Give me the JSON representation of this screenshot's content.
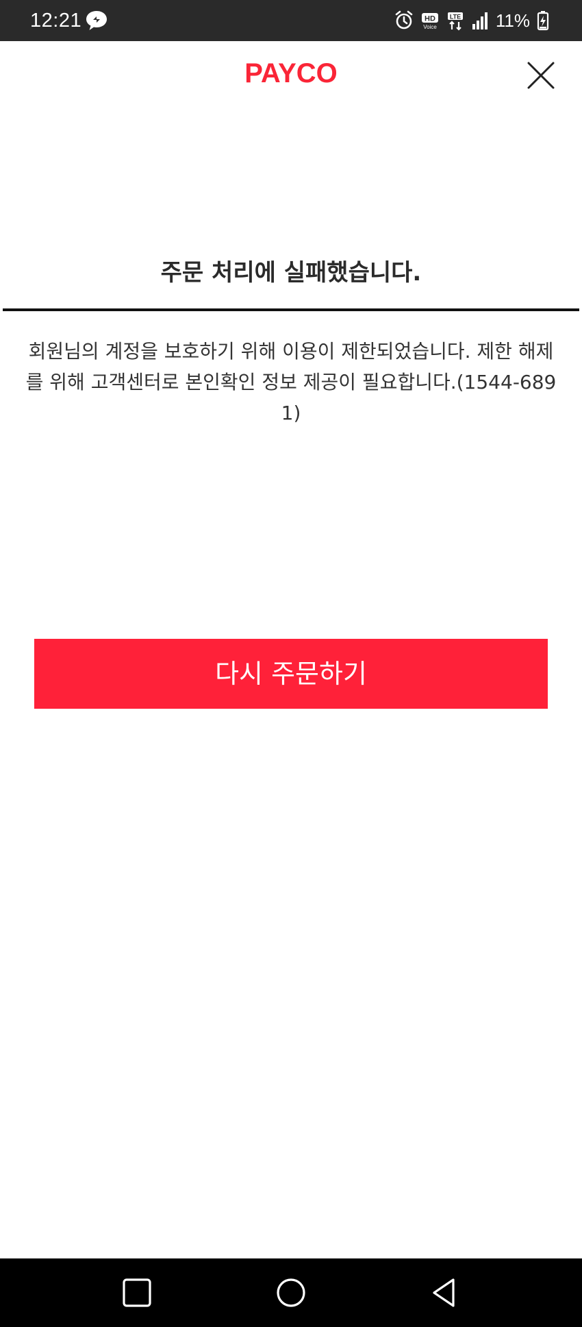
{
  "status_bar": {
    "time": "12:21",
    "battery_percent": "11%",
    "icons": [
      "chat-bubble-icon",
      "alarm-icon",
      "hd-voice-icon",
      "lte-icon",
      "signal-icon",
      "battery-charging-icon"
    ]
  },
  "header": {
    "brand": "PAYCO",
    "brand_color": "#fa2537",
    "close_icon": "close-icon"
  },
  "main": {
    "title": "주문 처리에 실패했습니다.",
    "message": "회원님의 계정을 보호하기 위해 이용이 제한되었습니다. 제한 해제를 위해 고객센터로 본인확인 정보 제공이 필요합니다.(1544-6891)",
    "retry_button_label": "다시 주문하기",
    "accent_color": "#ff2139"
  },
  "nav_bar": {
    "buttons": [
      "recents-icon",
      "home-icon",
      "back-icon"
    ]
  }
}
